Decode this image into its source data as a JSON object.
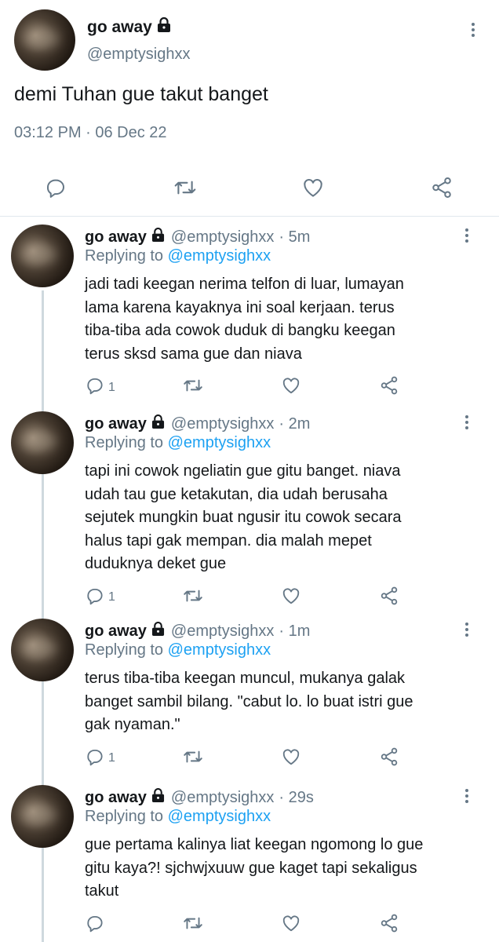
{
  "main_tweet": {
    "name": "go away",
    "handle": "@emptysighxx",
    "text": "demi Tuhan gue takut banget",
    "timestamp": "03:12 PM · 06 Dec 22"
  },
  "replies": [
    {
      "name": "go away",
      "handle": "@emptysighxx",
      "time": "· 5m",
      "replying_label": "Replying to",
      "replying_to": "@emptysighxx",
      "lines": [
        "jadi tadi keegan nerima telfon di luar, lumayan",
        "lama karena kayaknya ini soal kerjaan. terus",
        "tiba-tiba ada cowok duduk di bangku keegan",
        "terus sksd sama gue dan niava"
      ],
      "reply_count": "1"
    },
    {
      "name": "go away",
      "handle": "@emptysighxx",
      "time": "· 2m",
      "replying_label": "Replying to",
      "replying_to": "@emptysighxx",
      "lines": [
        "tapi ini cowok ngeliatin gue gitu banget. niava",
        "udah tau gue ketakutan, dia udah berusaha",
        "sejutek mungkin buat ngusir itu cowok secara",
        "halus tapi gak mempan. dia malah mepet",
        "duduknya deket gue"
      ],
      "reply_count": "1"
    },
    {
      "name": "go away",
      "handle": "@emptysighxx",
      "time": "· 1m",
      "replying_label": "Replying to",
      "replying_to": "@emptysighxx",
      "lines": [
        "terus tiba-tiba keegan muncul, mukanya galak",
        "banget sambil bilang. \"cabut lo. lo buat istri gue",
        "gak nyaman.\""
      ],
      "reply_count": "1"
    },
    {
      "name": "go away",
      "handle": "@emptysighxx",
      "time": "· 29s",
      "replying_label": "Replying to",
      "replying_to": "@emptysighxx",
      "lines": [
        "gue pertama kalinya liat keegan ngomong lo gue",
        "gitu kaya?! sjchwjxuuw gue kaget tapi sekaligus",
        "takut"
      ],
      "reply_count": ""
    }
  ],
  "icons": [
    "reply-icon",
    "retweet-icon",
    "like-icon",
    "share-icon",
    "lock-icon",
    "more-icon"
  ],
  "colors": {
    "link": "#1da1f2",
    "muted": "#657786",
    "text": "#14171a",
    "divider": "#e1e8ed"
  }
}
